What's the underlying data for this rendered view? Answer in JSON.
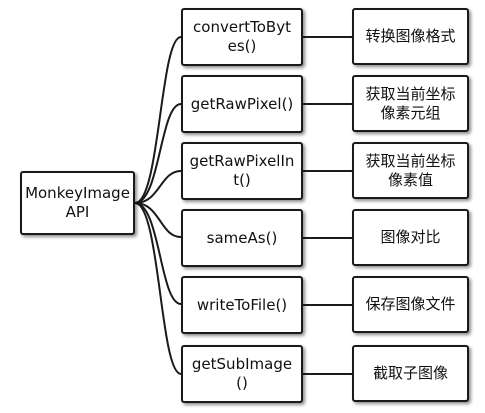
{
  "root": {
    "label_line1": "MonkeyImage",
    "label_line2": "API"
  },
  "items": [
    {
      "method": "convertToBytes()",
      "description": "转换图像格式"
    },
    {
      "method": "getRawPixel()",
      "description": "获取当前坐标像素元组"
    },
    {
      "method": "getRawPixelInt()",
      "description": "获取当前坐标像素值"
    },
    {
      "method": "sameAs()",
      "description": "图像对比"
    },
    {
      "method": "writeToFile()",
      "description": "保存图像文件"
    },
    {
      "method": "getSubImage()",
      "description": "截取子图像"
    }
  ]
}
